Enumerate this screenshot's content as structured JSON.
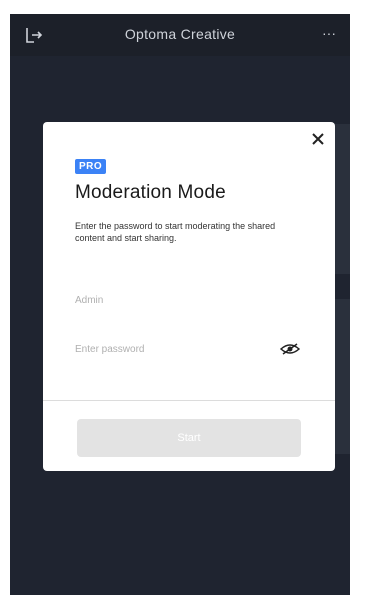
{
  "header": {
    "title": "Optoma Creative",
    "more_label": "···",
    "exit_icon": "exit-icon"
  },
  "modal": {
    "badge": "PRO",
    "title": "Moderation Mode",
    "description": "Enter the password to start moderating the shared content and start sharing.",
    "admin_placeholder": "Admin",
    "password_placeholder": "Enter password",
    "start_label": "Start",
    "close_icon": "close-icon",
    "eye_icon": "eye-icon"
  },
  "colors": {
    "background": "#1f2430",
    "header": "#1c2029",
    "badge": "#3b82f6",
    "button_disabled": "#e3e3e3"
  }
}
